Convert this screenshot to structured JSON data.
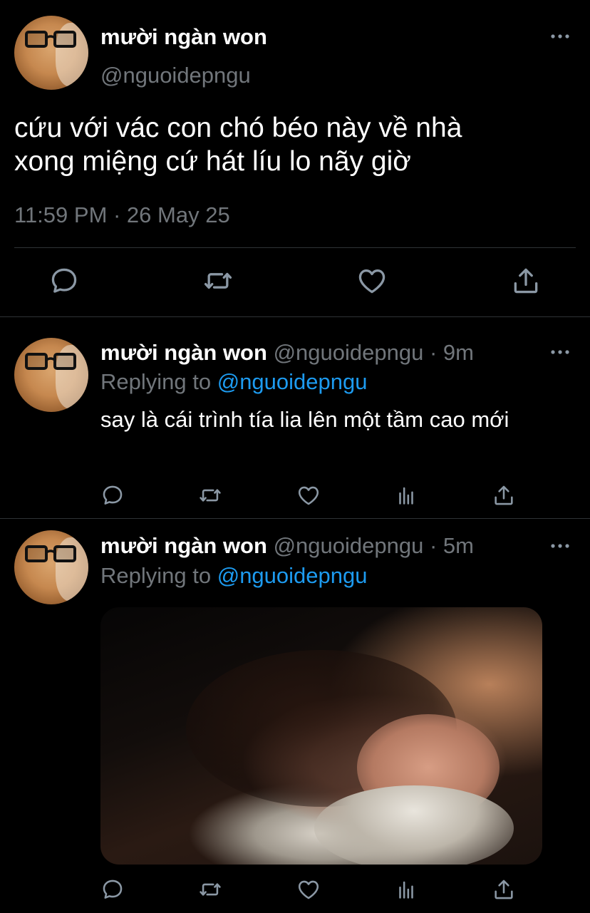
{
  "main_tweet": {
    "display_name": "mười ngàn won",
    "handle": "@nguoidepngu",
    "text_line1": "cứu với vác con chó béo này về nhà",
    "text_line2": "xong miệng cứ hát líu lo nãy giờ",
    "meta": "11:59 PM · 26 May 25",
    "actions": [
      "reply-icon",
      "retweet-icon",
      "like-icon",
      "share-icon"
    ]
  },
  "replies": [
    {
      "display_name": "mười ngàn won",
      "handle": "@nguoidepngu",
      "time": "· 9m",
      "replying_prefix": "Replying to",
      "replying_handle": "@nguoidepngu",
      "text": "say là cái trình tía lia lên một tầm cao mới",
      "actions": [
        "reply-icon",
        "retweet-icon",
        "like-icon",
        "analytics-icon",
        "share-icon"
      ]
    },
    {
      "display_name": "mười ngàn won",
      "handle": "@nguoidepngu",
      "time": "· 5m",
      "replying_prefix": "Replying to",
      "replying_handle": "@nguoidepngu",
      "media": "photo-of-sleeping-person",
      "actions": [
        "reply-icon",
        "retweet-icon",
        "like-icon",
        "analytics-icon",
        "share-icon"
      ]
    }
  ],
  "colors": {
    "background": "#000000",
    "text": "#e7e9ea",
    "muted": "#71767b",
    "link": "#1d9bf0",
    "divider": "#2f3336"
  }
}
